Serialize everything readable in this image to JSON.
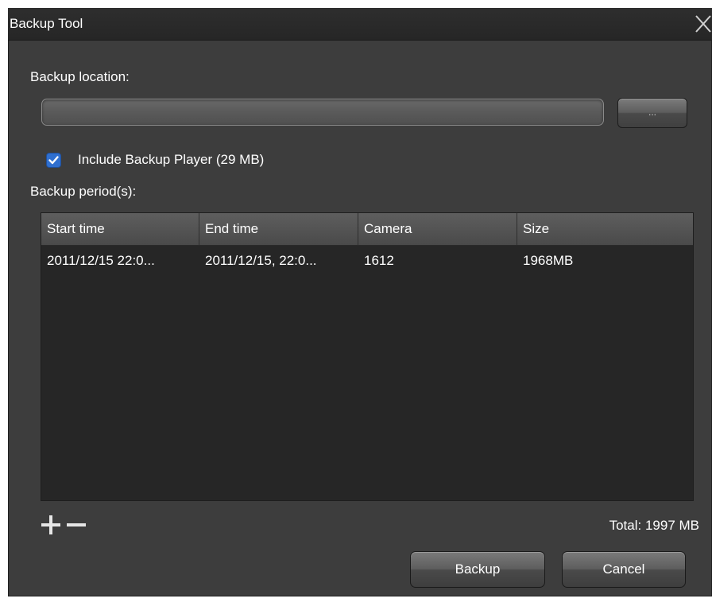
{
  "window": {
    "title": "Backup Tool"
  },
  "location": {
    "label": "Backup location:",
    "value": "",
    "browse_label": "..."
  },
  "include_player": {
    "checked": true,
    "label": "Include Backup Player (29 MB)"
  },
  "periods": {
    "label": "Backup period(s):",
    "columns": [
      "Start time",
      "End time",
      "Camera",
      "Size"
    ],
    "rows": [
      {
        "start": "2011/12/15 22:0...",
        "end": "2011/12/15, 22:0...",
        "camera": "1612",
        "size": "1968MB"
      }
    ]
  },
  "total": "Total: 1997 MB",
  "buttons": {
    "backup": "Backup",
    "cancel": "Cancel"
  },
  "icons": [
    "close-icon",
    "check-icon",
    "plus-icon",
    "minus-icon"
  ],
  "colors": {
    "window_bg": "#3d3d3d",
    "titlebar_bg": "#2a2a2a",
    "table_bg": "#262626",
    "header_bg": "#555555",
    "checkbox_accent": "#2f6fcf"
  }
}
